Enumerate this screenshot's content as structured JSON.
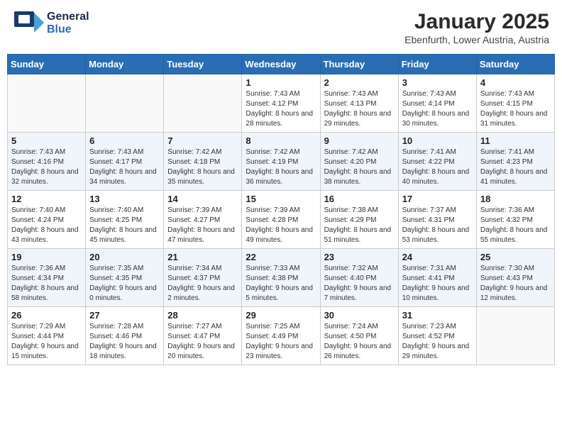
{
  "header": {
    "logo_general": "General",
    "logo_blue": "Blue",
    "month": "January 2025",
    "location": "Ebenfurth, Lower Austria, Austria"
  },
  "weekdays": [
    "Sunday",
    "Monday",
    "Tuesday",
    "Wednesday",
    "Thursday",
    "Friday",
    "Saturday"
  ],
  "weeks": [
    [
      {
        "day": "",
        "info": ""
      },
      {
        "day": "",
        "info": ""
      },
      {
        "day": "",
        "info": ""
      },
      {
        "day": "1",
        "info": "Sunrise: 7:43 AM\nSunset: 4:12 PM\nDaylight: 8 hours and 28 minutes."
      },
      {
        "day": "2",
        "info": "Sunrise: 7:43 AM\nSunset: 4:13 PM\nDaylight: 8 hours and 29 minutes."
      },
      {
        "day": "3",
        "info": "Sunrise: 7:43 AM\nSunset: 4:14 PM\nDaylight: 8 hours and 30 minutes."
      },
      {
        "day": "4",
        "info": "Sunrise: 7:43 AM\nSunset: 4:15 PM\nDaylight: 8 hours and 31 minutes."
      }
    ],
    [
      {
        "day": "5",
        "info": "Sunrise: 7:43 AM\nSunset: 4:16 PM\nDaylight: 8 hours and 32 minutes."
      },
      {
        "day": "6",
        "info": "Sunrise: 7:43 AM\nSunset: 4:17 PM\nDaylight: 8 hours and 34 minutes."
      },
      {
        "day": "7",
        "info": "Sunrise: 7:42 AM\nSunset: 4:18 PM\nDaylight: 8 hours and 35 minutes."
      },
      {
        "day": "8",
        "info": "Sunrise: 7:42 AM\nSunset: 4:19 PM\nDaylight: 8 hours and 36 minutes."
      },
      {
        "day": "9",
        "info": "Sunrise: 7:42 AM\nSunset: 4:20 PM\nDaylight: 8 hours and 38 minutes."
      },
      {
        "day": "10",
        "info": "Sunrise: 7:41 AM\nSunset: 4:22 PM\nDaylight: 8 hours and 40 minutes."
      },
      {
        "day": "11",
        "info": "Sunrise: 7:41 AM\nSunset: 4:23 PM\nDaylight: 8 hours and 41 minutes."
      }
    ],
    [
      {
        "day": "12",
        "info": "Sunrise: 7:40 AM\nSunset: 4:24 PM\nDaylight: 8 hours and 43 minutes."
      },
      {
        "day": "13",
        "info": "Sunrise: 7:40 AM\nSunset: 4:25 PM\nDaylight: 8 hours and 45 minutes."
      },
      {
        "day": "14",
        "info": "Sunrise: 7:39 AM\nSunset: 4:27 PM\nDaylight: 8 hours and 47 minutes."
      },
      {
        "day": "15",
        "info": "Sunrise: 7:39 AM\nSunset: 4:28 PM\nDaylight: 8 hours and 49 minutes."
      },
      {
        "day": "16",
        "info": "Sunrise: 7:38 AM\nSunset: 4:29 PM\nDaylight: 8 hours and 51 minutes."
      },
      {
        "day": "17",
        "info": "Sunrise: 7:37 AM\nSunset: 4:31 PM\nDaylight: 8 hours and 53 minutes."
      },
      {
        "day": "18",
        "info": "Sunrise: 7:36 AM\nSunset: 4:32 PM\nDaylight: 8 hours and 55 minutes."
      }
    ],
    [
      {
        "day": "19",
        "info": "Sunrise: 7:36 AM\nSunset: 4:34 PM\nDaylight: 8 hours and 58 minutes."
      },
      {
        "day": "20",
        "info": "Sunrise: 7:35 AM\nSunset: 4:35 PM\nDaylight: 9 hours and 0 minutes."
      },
      {
        "day": "21",
        "info": "Sunrise: 7:34 AM\nSunset: 4:37 PM\nDaylight: 9 hours and 2 minutes."
      },
      {
        "day": "22",
        "info": "Sunrise: 7:33 AM\nSunset: 4:38 PM\nDaylight: 9 hours and 5 minutes."
      },
      {
        "day": "23",
        "info": "Sunrise: 7:32 AM\nSunset: 4:40 PM\nDaylight: 9 hours and 7 minutes."
      },
      {
        "day": "24",
        "info": "Sunrise: 7:31 AM\nSunset: 4:41 PM\nDaylight: 9 hours and 10 minutes."
      },
      {
        "day": "25",
        "info": "Sunrise: 7:30 AM\nSunset: 4:43 PM\nDaylight: 9 hours and 12 minutes."
      }
    ],
    [
      {
        "day": "26",
        "info": "Sunrise: 7:29 AM\nSunset: 4:44 PM\nDaylight: 9 hours and 15 minutes."
      },
      {
        "day": "27",
        "info": "Sunrise: 7:28 AM\nSunset: 4:46 PM\nDaylight: 9 hours and 18 minutes."
      },
      {
        "day": "28",
        "info": "Sunrise: 7:27 AM\nSunset: 4:47 PM\nDaylight: 9 hours and 20 minutes."
      },
      {
        "day": "29",
        "info": "Sunrise: 7:25 AM\nSunset: 4:49 PM\nDaylight: 9 hours and 23 minutes."
      },
      {
        "day": "30",
        "info": "Sunrise: 7:24 AM\nSunset: 4:50 PM\nDaylight: 9 hours and 26 minutes."
      },
      {
        "day": "31",
        "info": "Sunrise: 7:23 AM\nSunset: 4:52 PM\nDaylight: 9 hours and 29 minutes."
      },
      {
        "day": "",
        "info": ""
      }
    ]
  ]
}
